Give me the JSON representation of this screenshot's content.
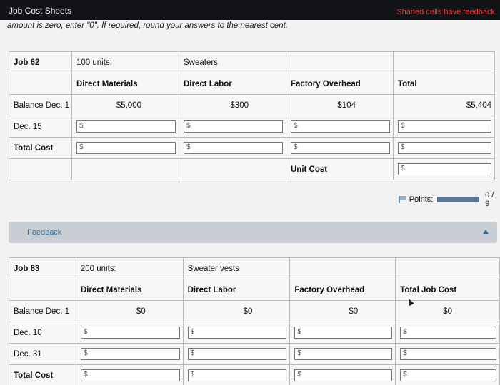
{
  "header": {
    "title": "Job Cost Sheets",
    "feedback_note": "Shaded cells have feedback."
  },
  "instructions": "amount is zero, enter \"0\". If required, round your answers to the nearest cent.",
  "job62": {
    "job": "Job 62",
    "units": "100 units:",
    "product": "Sweaters",
    "headers": {
      "dm": "Direct Materials",
      "dl": "Direct Labor",
      "foh": "Factory Overhead",
      "total": "Total"
    },
    "balance": {
      "label": "Balance Dec. 1",
      "dm": "$5,000",
      "dl": "$300",
      "foh": "$104",
      "total": "$5,404"
    },
    "row2": {
      "label": "Dec. 15"
    },
    "row3": {
      "label": "Total Cost"
    },
    "unit_cost_label": "Unit Cost",
    "currency": "$"
  },
  "points": {
    "label": "Points:",
    "score": "0 / 9"
  },
  "feedback": {
    "label": "Feedback"
  },
  "job83": {
    "job": "Job 83",
    "units": "200 units:",
    "product": "Sweater vests",
    "headers": {
      "dm": "Direct Materials",
      "dl": "Direct Labor",
      "foh": "Factory Overhead",
      "total": "Total Job Cost"
    },
    "balance": {
      "label": "Balance Dec. 1",
      "dm": "$0",
      "dl": "$0",
      "foh": "$0",
      "total": "$0"
    },
    "row2": {
      "label": "Dec. 10"
    },
    "row3": {
      "label": "Dec. 31"
    },
    "row4": {
      "label": "Total Cost"
    },
    "currency": "$"
  }
}
